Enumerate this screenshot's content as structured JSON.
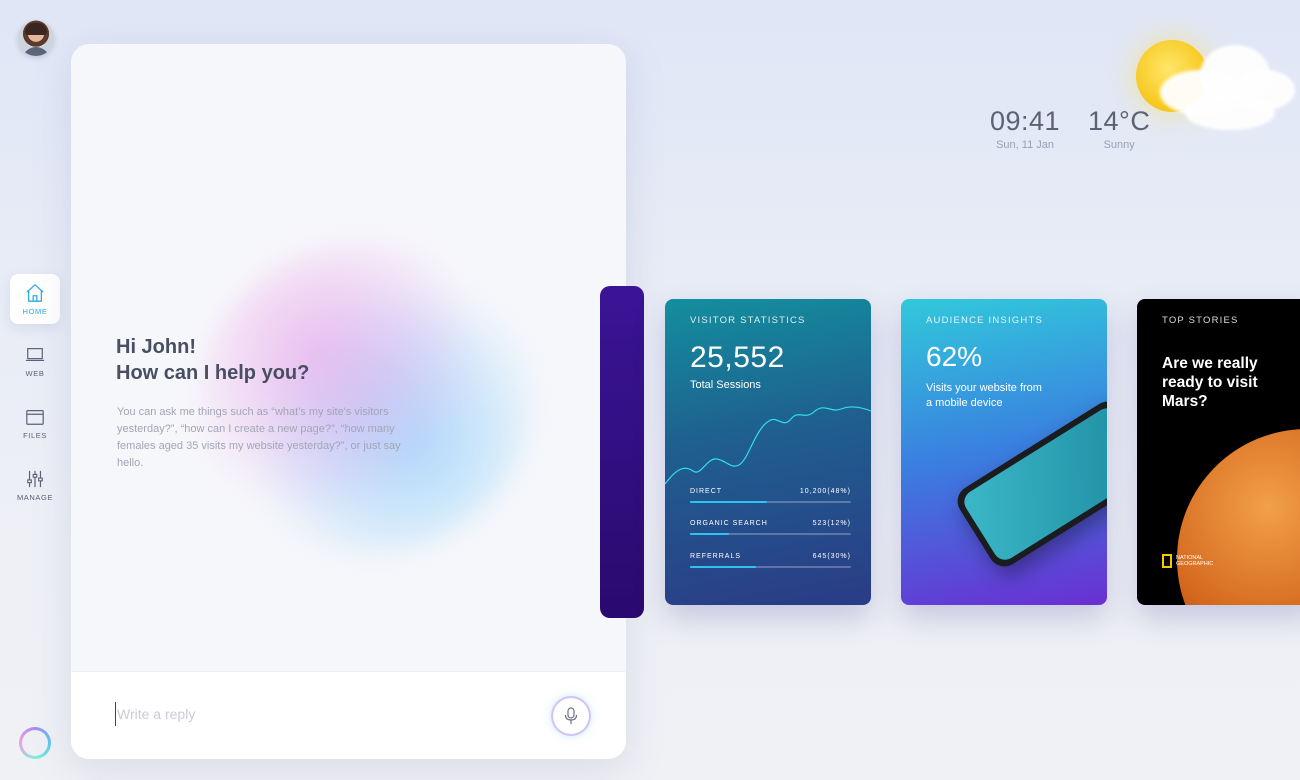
{
  "nav": {
    "items": [
      {
        "label": "HOME",
        "icon": "home-icon",
        "active": true
      },
      {
        "label": "WEB",
        "icon": "laptop-icon",
        "active": false
      },
      {
        "label": "FILES",
        "icon": "folder-icon",
        "active": false
      },
      {
        "label": "MANAGE",
        "icon": "sliders-icon",
        "active": false
      }
    ]
  },
  "assistant": {
    "greeting_line1": "Hi John!",
    "greeting_line2": "How can I help you?",
    "hint": "You can ask me things such as “what's my site's visitors yesterday?”, “how can I create a new page?”, “how many females aged 35 visits my website yesterday?”, or just say hello.",
    "reply_placeholder": "Write a reply"
  },
  "weather": {
    "time": "09:41",
    "date": "Sun, 11 Jan",
    "temperature": "14°C",
    "condition": "Sunny"
  },
  "cards": {
    "visitor": {
      "caption": "VISITOR STATISTICS",
      "total": "25,552",
      "total_label": "Total Sessions",
      "sources": [
        {
          "label": "DIRECT",
          "value": "10,200(48%)",
          "fraction": 0.48
        },
        {
          "label": "ORGANIC SEARCH",
          "value": "523(12%)",
          "fraction": 0.24
        },
        {
          "label": "REFERRALS",
          "value": "645(30%)",
          "fraction": 0.41
        }
      ]
    },
    "audience": {
      "caption": "AUDIENCE INSIGHTS",
      "percent": "62%",
      "description": "Visits your website from a mobile device"
    },
    "stories": {
      "caption": "TOP STORIES",
      "headline": "Are we really ready to visit Mars?",
      "brand": "NATIONAL GEOGRAPHIC"
    }
  },
  "colors": {
    "accent": "#31a9e6",
    "purple": "#6a2fd2",
    "teal": "#138f9e"
  }
}
